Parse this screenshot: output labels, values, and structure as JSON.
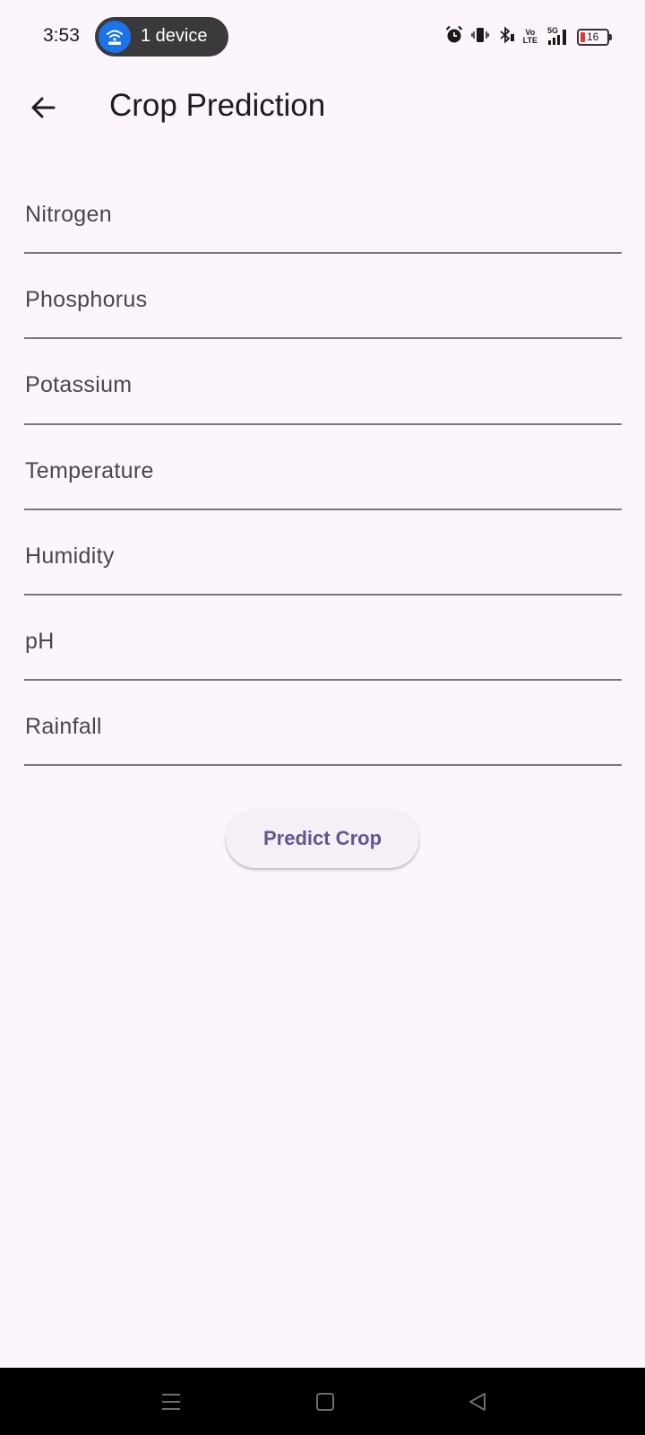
{
  "status_bar": {
    "time": "3:53",
    "hotspot_label": "1 device",
    "battery_level": "16",
    "network_label": "5G",
    "volte_top": "Vo",
    "volte_bottom": "LTE",
    "icons": [
      "alarm-icon",
      "vibrate-icon",
      "bluetooth-icon",
      "volte-icon",
      "signal-icon",
      "battery-icon"
    ]
  },
  "app_bar": {
    "title": "Crop Prediction",
    "back_icon": "arrow-left-icon"
  },
  "form": {
    "fields": [
      {
        "label": "Nitrogen",
        "value": ""
      },
      {
        "label": "Phosphorus",
        "value": ""
      },
      {
        "label": "Potassium",
        "value": ""
      },
      {
        "label": "Temperature",
        "value": ""
      },
      {
        "label": "Humidity",
        "value": ""
      },
      {
        "label": "pH",
        "value": ""
      },
      {
        "label": "Rainfall",
        "value": ""
      }
    ]
  },
  "actions": {
    "predict_label": "Predict Crop"
  },
  "nav_bar": {
    "icons": [
      "menu-icon",
      "home-icon",
      "back-triangle-icon"
    ]
  },
  "colors": {
    "background": "#fcf6fc",
    "button_text": "#65558f",
    "button_bg": "#f5eff7",
    "underline": "#7a767e"
  }
}
